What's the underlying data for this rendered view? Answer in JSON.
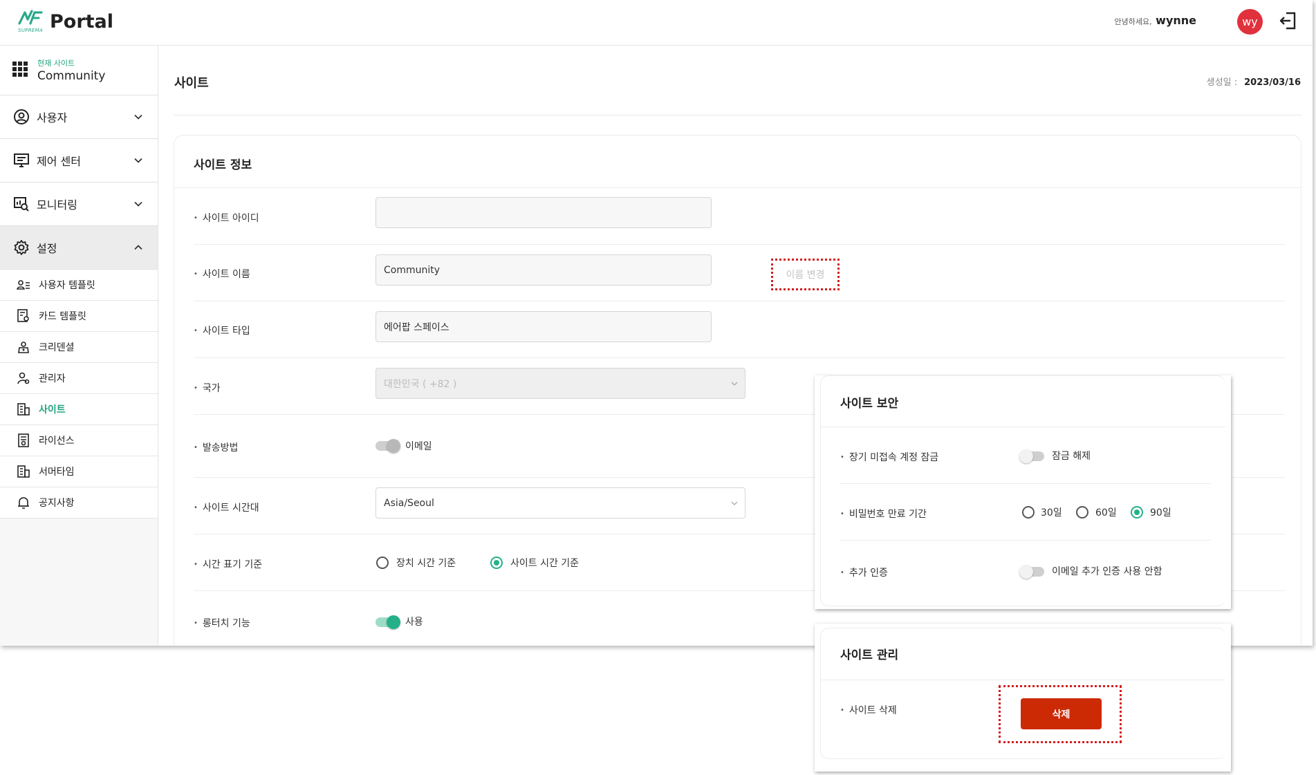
{
  "header": {
    "brand_sub": "SUPREMA",
    "brand_name": "Portal",
    "greeting": "안녕하세요,",
    "username": "wynne",
    "avatar_initials": "wy"
  },
  "sidebar": {
    "current_site_caption": "현재 사이트",
    "current_site_name": "Community",
    "menus": [
      {
        "label": "사용자"
      },
      {
        "label": "제어 센터"
      },
      {
        "label": "모니터링"
      },
      {
        "label": "설정"
      }
    ],
    "submenus": [
      {
        "label": "사용자 템플릿"
      },
      {
        "label": "카드 템플릿"
      },
      {
        "label": "크리덴셜"
      },
      {
        "label": "관리자"
      },
      {
        "label": "사이트"
      },
      {
        "label": "라이선스"
      },
      {
        "label": "서머타임"
      },
      {
        "label": "공지사항"
      }
    ]
  },
  "page": {
    "title": "사이트",
    "created_label": "생성일 :",
    "created_date": "2023/03/16"
  },
  "site_info": {
    "title": "사이트 정보",
    "site_id_label": "사이트 아이디",
    "site_id_value": "",
    "site_name_label": "사이트 이름",
    "site_name_value": "Community",
    "rename_button": "이름 변경",
    "site_type_label": "사이트 타입",
    "site_type_value": "에어팝 스페이스",
    "country_label": "국가",
    "country_value": "대한민국 ( +82 )",
    "send_method_label": "발송방법",
    "send_method_value": "이메일",
    "timezone_label": "사이트 시간대",
    "timezone_value": "Asia/Seoul",
    "time_display_label": "시간 표기 기준",
    "time_display_options": [
      "장치 시간 기준",
      "사이트 시간 기준"
    ],
    "time_display_selected": "사이트 시간 기준",
    "long_touch_label": "롱터치 기능",
    "long_touch_value": "사용"
  },
  "site_security": {
    "title": "사이트 보안",
    "lock_label": "장기 미접속 계정 잠금",
    "lock_value": "잠금 해제",
    "pw_expiry_label": "비밀번호 만료 기간",
    "pw_expiry_options": [
      "30일",
      "60일",
      "90일"
    ],
    "pw_expiry_selected": "90일",
    "extra_auth_label": "추가 인증",
    "extra_auth_value": "이메일 추가 인증 사용 안함"
  },
  "site_management": {
    "title": "사이트 관리",
    "delete_label": "사이트 삭제",
    "delete_button": "삭제"
  },
  "colors": {
    "accent": "#25b08a",
    "avatar": "#e0313d",
    "danger": "#cc2a05",
    "highlight": "#d21c1c"
  }
}
